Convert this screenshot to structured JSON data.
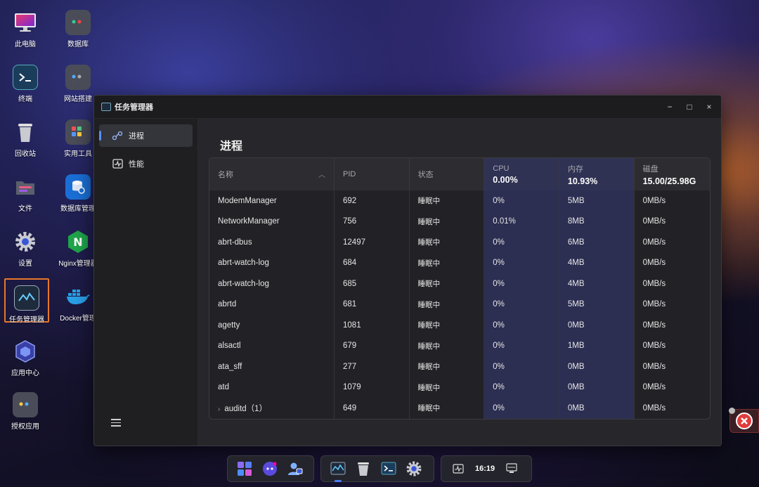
{
  "desktop": {
    "icons": [
      {
        "label": "此电脑",
        "icon": "monitor-icon"
      },
      {
        "label": "数据库",
        "icon": "database-folder-icon"
      },
      {
        "label": "终端",
        "icon": "terminal-icon"
      },
      {
        "label": "网站搭建",
        "icon": "website-folder-icon"
      },
      {
        "label": "回收站",
        "icon": "trash-icon"
      },
      {
        "label": "实用工具",
        "icon": "tools-folder-icon"
      },
      {
        "label": "文件",
        "icon": "folder-icon"
      },
      {
        "label": "数据库管理",
        "icon": "database-manage-icon"
      },
      {
        "label": "设置",
        "icon": "gear-icon"
      },
      {
        "label": "Nginx管理器",
        "icon": "nginx-icon"
      },
      {
        "label": "任务管理器",
        "icon": "task-manager-icon"
      },
      {
        "label": "Docker管理",
        "icon": "docker-icon"
      },
      {
        "label": "应用中心",
        "icon": "app-center-icon"
      },
      {
        "label": "授权应用",
        "icon": "authorized-apps-icon"
      }
    ]
  },
  "window": {
    "title": "任务管理器",
    "controls": {
      "minimize": "−",
      "maximize": "□",
      "close": "×"
    }
  },
  "sidebar": {
    "items": [
      {
        "label": "进程",
        "icon": "process-icon",
        "active": true
      },
      {
        "label": "性能",
        "icon": "performance-icon",
        "active": false
      }
    ]
  },
  "main": {
    "heading": "进程",
    "columns": {
      "name": "名称",
      "pid": "PID",
      "state": "状态",
      "cpu": {
        "label": "CPU",
        "value": "0.00%"
      },
      "mem": {
        "label": "内存",
        "value": "10.93%"
      },
      "disk": {
        "label": "磁盘",
        "value": "15.00/25.98G"
      }
    },
    "rows": [
      {
        "name": "ModemManager",
        "pid": "692",
        "state": "睡眠中",
        "cpu": "0%",
        "mem": "5MB",
        "disk": "0MB/s"
      },
      {
        "name": "NetworkManager",
        "pid": "756",
        "state": "睡眠中",
        "cpu": "0.01%",
        "mem": "8MB",
        "disk": "0MB/s"
      },
      {
        "name": "abrt-dbus",
        "pid": "12497",
        "state": "睡眠中",
        "cpu": "0%",
        "mem": "6MB",
        "disk": "0MB/s"
      },
      {
        "name": "abrt-watch-log",
        "pid": "684",
        "state": "睡眠中",
        "cpu": "0%",
        "mem": "4MB",
        "disk": "0MB/s"
      },
      {
        "name": "abrt-watch-log",
        "pid": "685",
        "state": "睡眠中",
        "cpu": "0%",
        "mem": "4MB",
        "disk": "0MB/s"
      },
      {
        "name": "abrtd",
        "pid": "681",
        "state": "睡眠中",
        "cpu": "0%",
        "mem": "5MB",
        "disk": "0MB/s"
      },
      {
        "name": "agetty",
        "pid": "1081",
        "state": "睡眠中",
        "cpu": "0%",
        "mem": "0MB",
        "disk": "0MB/s"
      },
      {
        "name": "alsactl",
        "pid": "679",
        "state": "睡眠中",
        "cpu": "0%",
        "mem": "1MB",
        "disk": "0MB/s"
      },
      {
        "name": "ata_sff",
        "pid": "277",
        "state": "睡眠中",
        "cpu": "0%",
        "mem": "0MB",
        "disk": "0MB/s"
      },
      {
        "name": "atd",
        "pid": "1079",
        "state": "睡眠中",
        "cpu": "0%",
        "mem": "0MB",
        "disk": "0MB/s"
      },
      {
        "name": "auditd（1）",
        "pid": "649",
        "state": "睡眠中",
        "cpu": "0%",
        "mem": "0MB",
        "disk": "0MB/s",
        "expandable": true
      }
    ]
  },
  "taskbar": {
    "clock": "16:19"
  },
  "colors": {
    "accent": "#4c7ef0",
    "highlight_column": "#2c2e52",
    "selection_border": "#e6772c"
  }
}
